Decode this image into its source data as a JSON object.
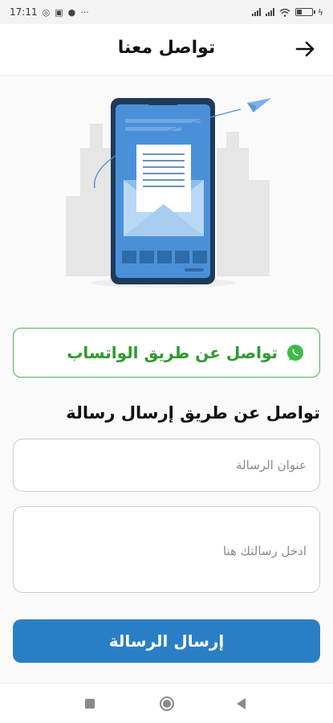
{
  "status_bar": {
    "time": "17:11",
    "more": "···",
    "icons": [
      "whatsapp-icon",
      "tv-icon",
      "app-icon",
      "signal-icon",
      "signal-icon",
      "wifi-icon",
      "battery-icon",
      "charging-icon"
    ],
    "battery_level": 0.35
  },
  "header": {
    "title": "تواصل معنا",
    "back_icon": "arrow-right-icon"
  },
  "illustration": {
    "icon": "phone-mail-illustration"
  },
  "whatsapp": {
    "label": "تواصل عن طريق الواتساب",
    "icon": "whatsapp-icon",
    "color": "#2e9a2e"
  },
  "form": {
    "section_title": "تواصل عن طريق إرسال رسالة",
    "subject_placeholder": "عنوان الرسالة",
    "subject_value": "",
    "message_placeholder": "ادخل رسالتك هنا",
    "message_value": "",
    "send_label": "إرسال الرسالة",
    "accent": "#2a7fc4"
  },
  "nav_bar": {
    "icons": [
      "recents-square-icon",
      "home-circle-icon",
      "back-triangle-icon"
    ]
  }
}
